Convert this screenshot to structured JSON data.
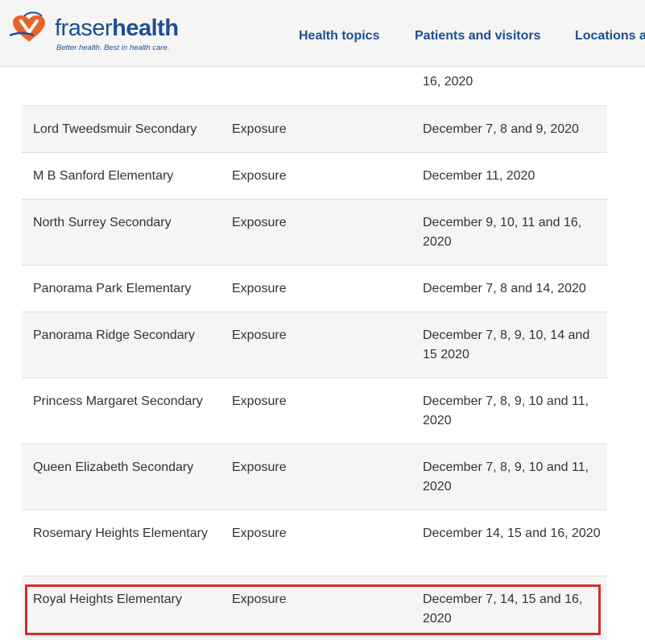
{
  "brand": {
    "name_part1": "fraser",
    "name_part2": "health",
    "tagline": "Better health. Best in health care.",
    "primary_color": "#1d4f91",
    "accent_color": "#e8632a"
  },
  "nav": {
    "items": [
      "Health topics",
      "Patients and visitors",
      "Locations a"
    ]
  },
  "table": {
    "partial_row": {
      "school": "",
      "type": "",
      "dates": "16, 2020"
    },
    "rows": [
      {
        "school": "Lord Tweedsmuir Secondary",
        "type": "Exposure",
        "dates": "December 7, 8 and 9, 2020"
      },
      {
        "school": "M B Sanford Elementary",
        "type": "Exposure",
        "dates": "December 11, 2020"
      },
      {
        "school": "North Surrey Secondary",
        "type": "Exposure",
        "dates": "December 9, 10, 11 and 16, 2020"
      },
      {
        "school": "Panorama Park Elementary",
        "type": "Exposure",
        "dates": "December 7, 8 and 14, 2020"
      },
      {
        "school": "Panorama Ridge Secondary",
        "type": "Exposure",
        "dates": "December 7, 8, 9, 10, 14 and 15 2020"
      },
      {
        "school": "Princess Margaret Secondary",
        "type": "Exposure",
        "dates": "December 7, 8, 9, 10 and 11, 2020"
      },
      {
        "school": "Queen Elizabeth Secondary",
        "type": "Exposure",
        "dates": "December 7, 8, 9, 10 and 11, 2020"
      },
      {
        "school": "Rosemary Heights Elementary",
        "type": "Exposure",
        "dates": "December 14, 15 and 16, 2020"
      },
      {
        "school": "Royal Heights Elementary",
        "type": "Exposure",
        "dates": "December 7, 14, 15 and 16, 2020"
      }
    ],
    "highlighted_row_index": 8,
    "highlight_color": "#d52b2b"
  }
}
